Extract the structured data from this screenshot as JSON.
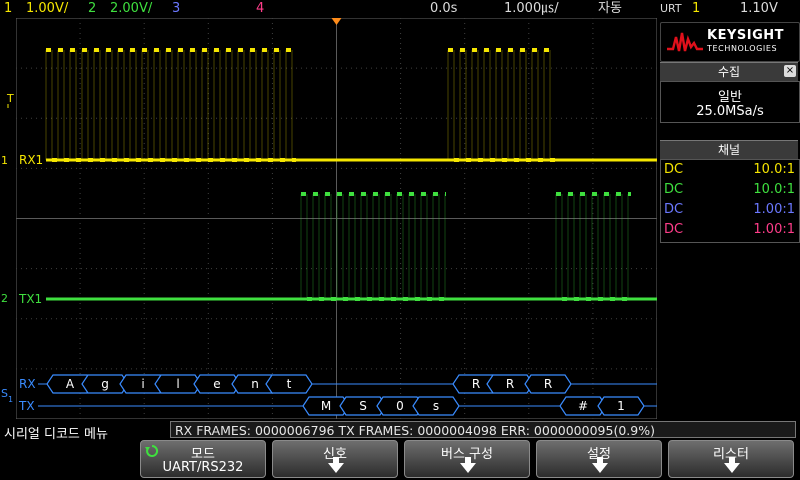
{
  "status": {
    "ch1_scale": "1.00V/",
    "ch2_scale": "2.00V/",
    "ch3_num": "3",
    "ch4_num": "4",
    "delay": "0.0s",
    "timebase": "1.000㎲/",
    "trigger_mode": "자동",
    "trigger_source": "URT",
    "trigger_channel": "1",
    "trigger_level": "1.10V",
    "ch1_num": "1",
    "ch2_num": "2"
  },
  "logo": {
    "brand": "KEYSIGHT",
    "sub": "TECHNOLOGIES"
  },
  "acquisition": {
    "title": "수집",
    "mode": "일반",
    "rate": "25.0MSa/s"
  },
  "channels": {
    "title": "채널",
    "rows": [
      {
        "coupling": "DC",
        "ratio": "10.0:1",
        "color": "#f5e600"
      },
      {
        "coupling": "DC",
        "ratio": "10.0:1",
        "color": "#3fe03f"
      },
      {
        "coupling": "DC",
        "ratio": "1.00:1",
        "color": "#6b78ff"
      },
      {
        "coupling": "DC",
        "ratio": "1.00:1",
        "color": "#ff3d8a"
      }
    ]
  },
  "traces": {
    "rx_label": "RX1",
    "tx_label": "TX1",
    "rx_marker": "1",
    "tx_marker": "2",
    "trigger_marker": "T",
    "serial_marker": "S",
    "serial_sub": "1"
  },
  "decode": {
    "rx_label": "RX",
    "tx_label": "TX",
    "rx_chars": [
      "A",
      "g",
      "i",
      "l",
      "e",
      "n",
      "t",
      "R",
      "R",
      "R"
    ],
    "tx_chars": [
      "M",
      "S",
      "0",
      "s",
      "#",
      "1"
    ]
  },
  "bottom": {
    "menu_title": "시리얼 디코드 메뉴",
    "frames_text": "RX FRAMES: 0000006796  TX FRAMES: 0000004098  ERR: 0000000095(0.9%)",
    "softkeys": [
      {
        "label": "모드",
        "value": "UART/RS232"
      },
      {
        "label": "신호"
      },
      {
        "label": "버스 구성"
      },
      {
        "label": "설정"
      },
      {
        "label": "리스터"
      }
    ]
  },
  "colors": {
    "ch1": "#f5e600",
    "ch2": "#3fe03f",
    "decode": "#3a8cff",
    "grid": "#404040"
  }
}
